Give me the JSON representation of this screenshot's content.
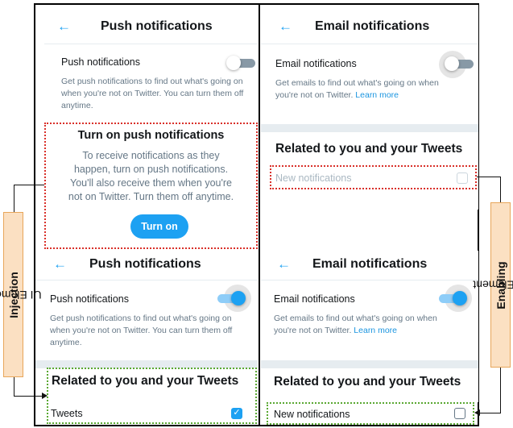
{
  "colors": {
    "accent": "#1da1f2",
    "injection_box": "#d9302a",
    "enabling_box": "#5aa832",
    "side_label_bg": "#fbe0c2"
  },
  "labels": {
    "left_prefix": "UI Element ",
    "left_bold": "Injection",
    "right_prefix": "UI Element ",
    "right_bold": "Enabling"
  },
  "push_top": {
    "back_icon": "arrow-left-icon",
    "title": "Push notifications",
    "toggle_label": "Push notifications",
    "toggle_state": "off",
    "description": "Get push notifications to find out what's going on when you're not on Twitter. You can turn them off anytime.",
    "dialog": {
      "title": "Turn on push notifications",
      "text": "To receive notifications as they happen, turn on push notifications. You'll also receive them when you're not on Twitter. Turn them off anytime.",
      "button": "Turn on"
    }
  },
  "push_bottom": {
    "back_icon": "arrow-left-icon",
    "title": "Push notifications",
    "toggle_label": "Push notifications",
    "toggle_state": "on",
    "description": "Get push notifications to find out what's going on when you're not on Twitter. You can turn them off anytime.",
    "section": "Related to you and your Tweets",
    "item": "Tweets",
    "item_checked": true
  },
  "email_top": {
    "back_icon": "arrow-left-icon",
    "title": "Email notifications",
    "toggle_label": "Email notifications",
    "toggle_state": "off",
    "description": "Get emails to find out what's going on when you're not on Twitter.",
    "learn_more": "Learn more",
    "section": "Related to you and your Tweets",
    "item": "New notifications",
    "item_disabled": true
  },
  "email_bottom": {
    "back_icon": "arrow-left-icon",
    "title": "Email notifications",
    "toggle_label": "Email notifications",
    "toggle_state": "on",
    "description": "Get emails to find out what's going on when you're not on Twitter.",
    "learn_more": "Learn more",
    "section": "Related to you and your Tweets",
    "item": "New notifications",
    "item_checked": false
  }
}
